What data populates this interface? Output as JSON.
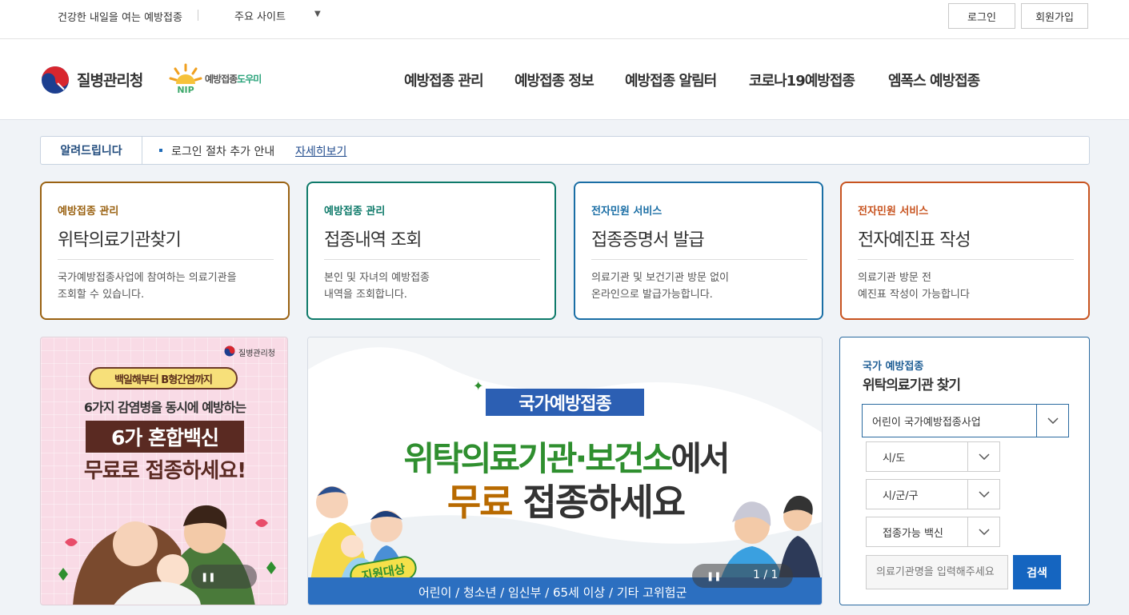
{
  "topbar": {
    "slogan": "건강한 내일을 여는 예방접종",
    "sites": "주요 사이트",
    "login": "로그인",
    "join": "회원가입"
  },
  "header": {
    "agency": "질병관리청",
    "nip_main": "예방접종",
    "nip_sub": "도우미",
    "nip_letters": "NIP",
    "menu": [
      "예방접종 관리",
      "예방접종 정보",
      "예방접종 알림터",
      "코로나19예방접종",
      "엠폭스 예방접종"
    ]
  },
  "notice": {
    "label": "알려드립니다",
    "text": "로그인 절차 추가 안내",
    "more": "자세히보기"
  },
  "cards": [
    {
      "category": "예방접종 관리",
      "title": "위탁의료기관찾기",
      "desc": "국가예방접종사업에 참여하는 의료기관을\n조회할 수 있습니다.",
      "color": "#9a6212"
    },
    {
      "category": "예방접종 관리",
      "title": "접종내역 조회",
      "desc": "본인 및 자녀의 예방접종\n내역을 조회합니다.",
      "color": "#0e7a6a"
    },
    {
      "category": "전자민원 서비스",
      "title": "접종증명서 발급",
      "desc": "의료기관 및 보건기관 방문 없이\n온라인으로 발급가능합니다.",
      "color": "#1a6ea5"
    },
    {
      "category": "전자민원 서비스",
      "title": "전자예진표 작성",
      "desc": "의료기관 방문 전\n예진표 작성이 가능합니다",
      "color": "#c8531f"
    }
  ],
  "banner_left": {
    "agency": "질병관리청",
    "ribbon": "백일해부터 B형간염까지",
    "line1": "6가지 감염병을 동시에 예방하는",
    "line2": "6가 혼합백신",
    "line3": "무료로 접종하세요!"
  },
  "banner_main": {
    "tag": "국가예방접종",
    "headline_green": "위탁의료기관·보건소",
    "headline_dark": "에서",
    "line2_orange": "무료",
    "line2_dark": "접종하세요",
    "support_badge": "지원대상",
    "targets": "어린이 / 청소년 / 임신부 / 65세 이상 / 기타 고위험군",
    "counter": "1 / 1"
  },
  "search": {
    "subtitle": "국가 예방접종",
    "title": "위탁의료기관 찾기",
    "program": "어린이 국가예방접종사업",
    "region": "시/도",
    "district": "시/군/구",
    "vaccine": "접종가능 백신",
    "placeholder": "의료기관명을 입력해주세요",
    "button": "검색"
  },
  "colors": {
    "accent": "#1565c0",
    "green_headline": "#2f8f2f",
    "orange_headline": "#b86a00",
    "navy_tag": "#2c5fb3"
  }
}
